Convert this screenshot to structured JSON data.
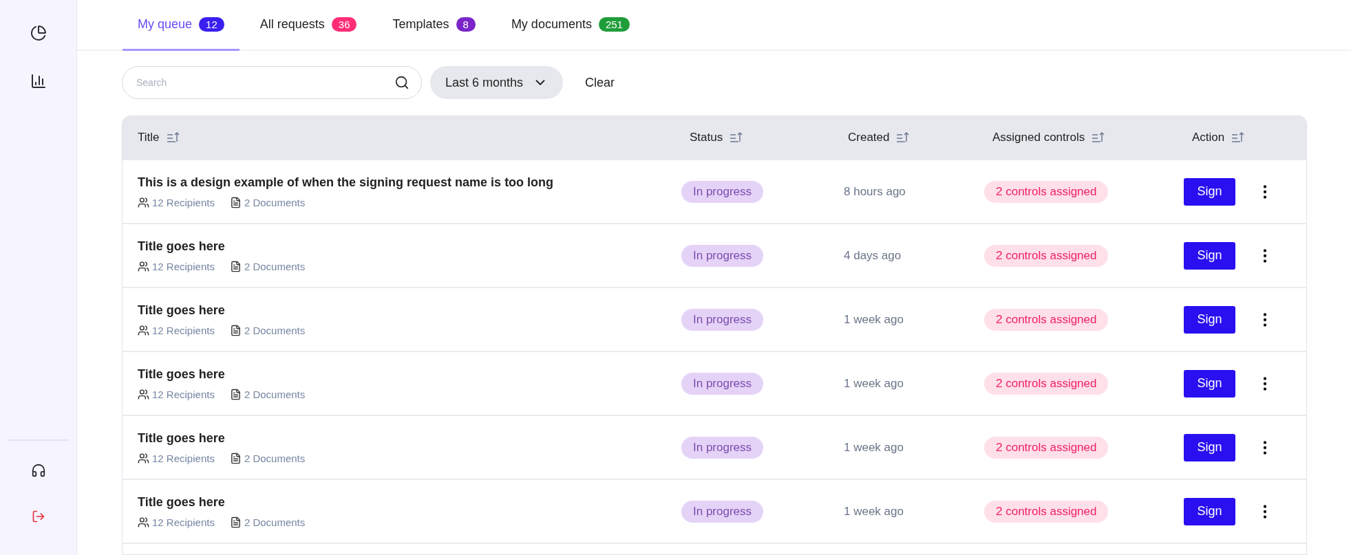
{
  "tabs": [
    {
      "label": "My queue",
      "count": "12",
      "color": "#3a1ff0",
      "selected": true
    },
    {
      "label": "All requests",
      "count": "36",
      "color": "#ff2d78",
      "selected": false
    },
    {
      "label": "Templates",
      "count": "8",
      "color": "#7b25c9",
      "selected": false
    },
    {
      "label": "My documents",
      "count": "251",
      "color": "#1f9d3a",
      "selected": false
    }
  ],
  "search": {
    "placeholder": "Search"
  },
  "date_filter": {
    "value": "Last 6 months"
  },
  "clear_button": "Clear",
  "table": {
    "columns": [
      "Title",
      "Status",
      "Created",
      "Assigned controls",
      "Action"
    ],
    "rows": [
      {
        "title": "This is a design example of when the signing request name is too long",
        "recipients": "12 Recipients",
        "documents": "2 Documents",
        "status": "In progress",
        "created": "8 hours ago",
        "assigned": "2 controls assigned",
        "action": "Sign"
      },
      {
        "title": "Title goes here",
        "recipients": "12 Recipients",
        "documents": "2 Documents",
        "status": "In progress",
        "created": "4 days ago",
        "assigned": "2 controls assigned",
        "action": "Sign"
      },
      {
        "title": "Title goes here",
        "recipients": "12 Recipients",
        "documents": "2 Documents",
        "status": "In progress",
        "created": "1 week ago",
        "assigned": "2 controls assigned",
        "action": "Sign"
      },
      {
        "title": "Title goes here",
        "recipients": "12 Recipients",
        "documents": "2 Documents",
        "status": "In progress",
        "created": "1 week ago",
        "assigned": "2 controls assigned",
        "action": "Sign"
      },
      {
        "title": "Title goes here",
        "recipients": "12 Recipients",
        "documents": "2 Documents",
        "status": "In progress",
        "created": "1 week ago",
        "assigned": "2 controls assigned",
        "action": "Sign"
      },
      {
        "title": "Title goes here",
        "recipients": "12 Recipients",
        "documents": "2 Documents",
        "status": "In progress",
        "created": "1 week ago",
        "assigned": "2 controls assigned",
        "action": "Sign"
      }
    ]
  }
}
